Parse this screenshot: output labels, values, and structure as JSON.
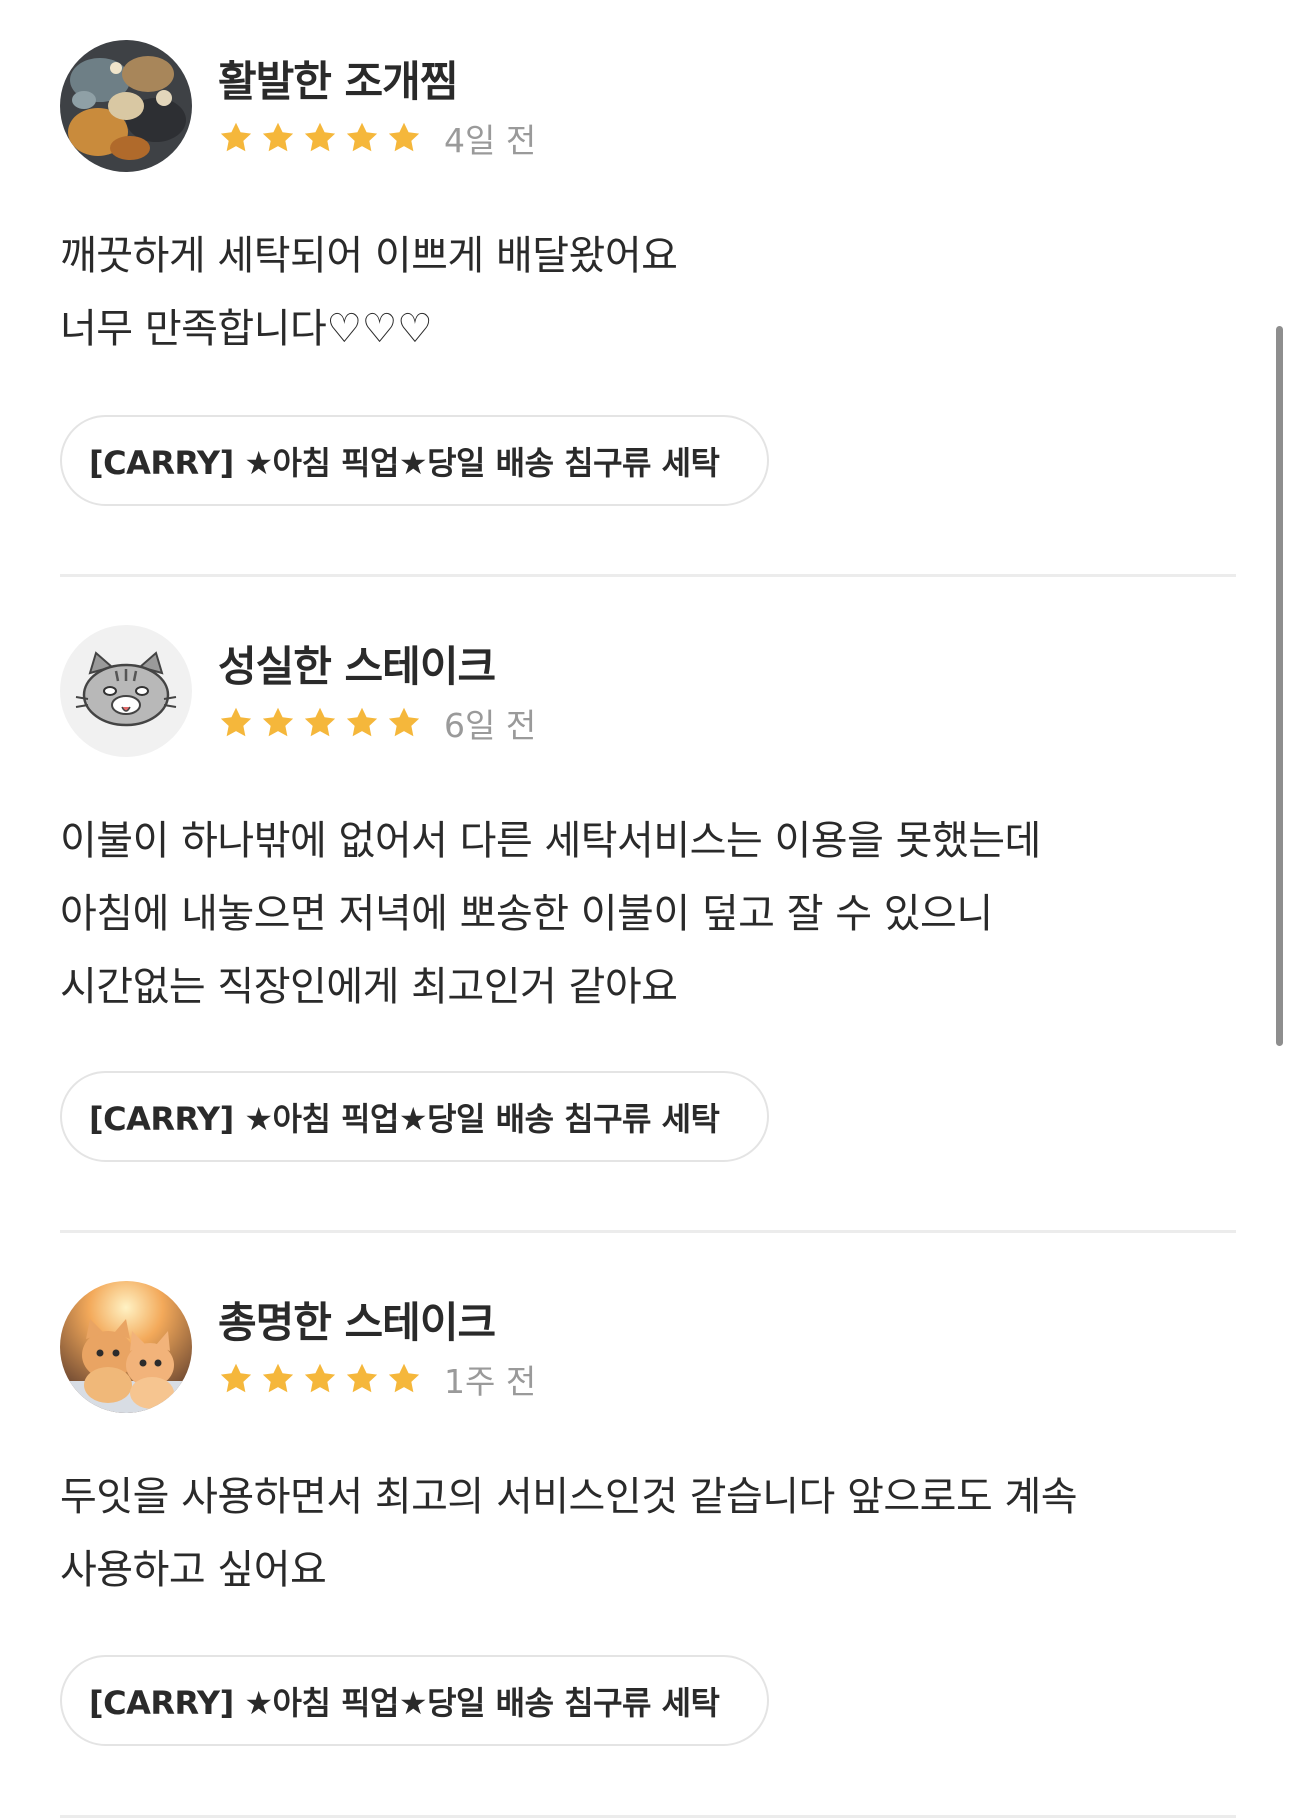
{
  "reviews": [
    {
      "author": "활발한 조개찜",
      "rating": 5,
      "date": "4일 전",
      "lines": [
        "깨끗하게 세탁되어 이쁘게 배달왔어요",
        "너무 만족합니다♡♡♡"
      ],
      "product": "[CARRY] ★아침 픽업★당일 배송 침구류 세탁",
      "avatar_icon": "seafood-photo-avatar"
    },
    {
      "author": "성실한 스테이크",
      "rating": 5,
      "date": "6일 전",
      "lines": [
        "이불이 하나밖에 없어서 다른 세탁서비스는 이용을 못했는데",
        "아침에 내놓으면 저녁에 뽀송한 이불이 덮고 잘 수 있으니",
        "시간없는 직장인에게 최고인거 같아요"
      ],
      "product": "[CARRY] ★아침 픽업★당일 배송 침구류 세탁",
      "avatar_icon": "cartoon-cat-avatar"
    },
    {
      "author": "총명한 스테이크",
      "rating": 5,
      "date": "1주 전",
      "lines": [
        "두잇을 사용하면서 최고의 서비스인것 같습니다 앞으로도 계속",
        "사용하고 싶어요"
      ],
      "product": "[CARRY] ★아침 픽업★당일 배송 침구류 세탁",
      "avatar_icon": "kittens-photo-avatar"
    }
  ],
  "colors": {
    "star": "#F5B73B",
    "text": "#2A2A2A",
    "meta": "#9A9A9A",
    "border": "#E4E4E4",
    "divider": "#ECECEC"
  }
}
